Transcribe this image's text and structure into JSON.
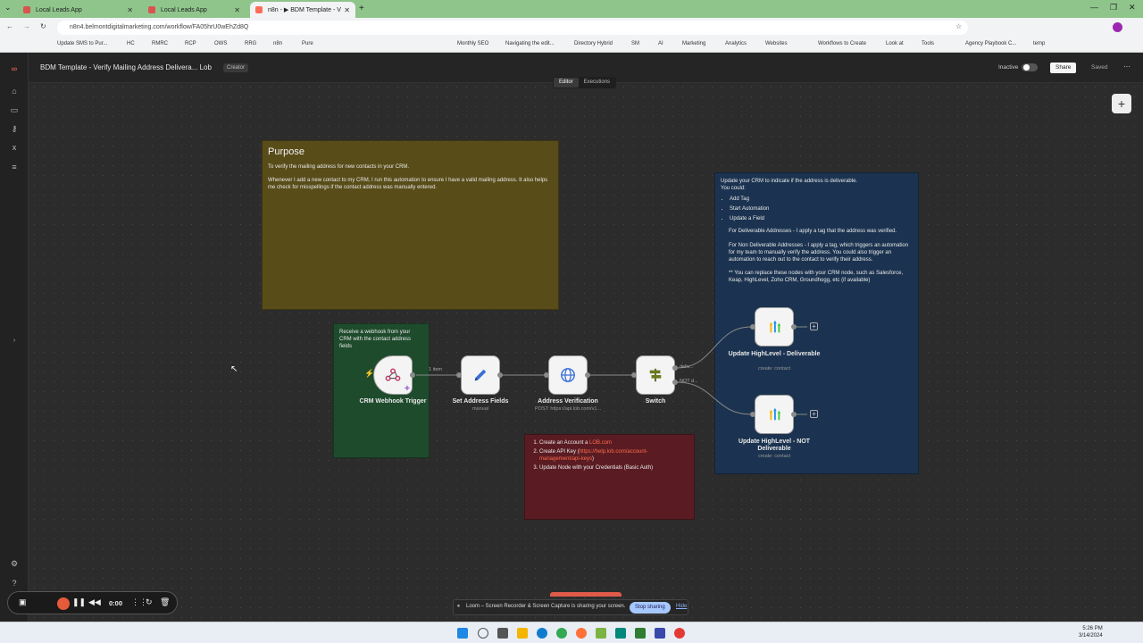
{
  "browser": {
    "tabs": [
      {
        "label": "Local Leads App"
      },
      {
        "label": "Local Leads App"
      },
      {
        "label": "n8n - ▶ BDM Template - V"
      }
    ],
    "url": "n8n4.belmontdigitalmarketing.com/workflow/FA05hrU0wEhZd8Q",
    "bookmarks": [
      "Update SMS to Pur...",
      "HC",
      "RMRC",
      "RCP",
      "OWS",
      "RRG",
      "n8n",
      "Pure",
      "Monthly SEO",
      "Navigating the edit...",
      "Directory Hybrid",
      "SM",
      "AI",
      "Marketing",
      "Analytics",
      "Websites",
      "Workflows to Create",
      "Look at",
      "Tools",
      "Agency Playbook C...",
      "temp"
    ]
  },
  "header": {
    "title": "BDM Template - Verify Mailing Address Delivera... Lob",
    "creator_badge": "Creator",
    "status": "Inactive",
    "share_label": "Share",
    "saved_label": "Saved",
    "editor_tab": "Editor",
    "executions_tab": "Executions"
  },
  "notes": {
    "purpose": {
      "title": "Purpose",
      "line1": "To verify the mailing address for new contacts in your CRM.",
      "line2": "Whenever I add a new contact to my CRM, I run this automation to ensure I have a valid mailing address. It also helps me check for misspellings if the contact address was manually entered."
    },
    "webhook": "Receive a webhook from your CRM with the contact address fields",
    "crm": {
      "intro": "Update your CRM to indicate if the address is deliverable.",
      "could": "You could:",
      "items": [
        "Add Tag",
        "Start Automation",
        "Update a Field"
      ],
      "deliverable": "For Deliverable Addresses - I apply a tag that the address was verified.",
      "non_deliverable": "For Non Deliverable Addresses - I apply a tag, which triggers an automation for my team to manually verify the address. You could also trigger an automation to reach out to the contact to verify their address.",
      "replace": "** You can replace these nodes with your CRM node, such as Salesforce, Keap, HighLevel, Zoho CRM, Groundhogg, etc (if available)"
    },
    "setup": {
      "step1_text": "Create an Account a ",
      "step1_link": "LOB.com",
      "step2_text": "Create API Key (",
      "step2_link": "https://help.lob.com/account-management/api-keys",
      "step2_end": ")",
      "step3_text": "Update Node with your Credentials (Basic Auth)"
    }
  },
  "nodes": {
    "webhook": {
      "label": "CRM Webhook Trigger"
    },
    "set_fields": {
      "label": "Set Address Fields",
      "sub": "manual"
    },
    "address_verification": {
      "label": "Address Verification",
      "sub": "POST: https://api.lob.com/v1..."
    },
    "switch": {
      "label": "Switch",
      "out1": "deliv...",
      "out2": "NOT d..."
    },
    "update_deliverable": {
      "label": "Update HighLevel - Deliverable",
      "sub": "create: contact"
    },
    "update_not_deliverable": {
      "label": "Update HighLevel - NOT Deliverable",
      "sub": "create: contact"
    },
    "connection_label": "1 item"
  },
  "recorder": {
    "time": "0:00"
  },
  "loom": {
    "message": "Loom – Screen Recorder & Screen Capture is sharing your screen.",
    "stop_label": "Stop sharing",
    "hide_label": "Hide"
  },
  "taskbar": {
    "time": "5:26 PM",
    "date": "3/14/2024"
  },
  "colors": {
    "accent": "#ff6d5a",
    "purpose_note": "#584c19",
    "crm_note": "#1b3350",
    "webhook_note": "#1e4b2c",
    "setup_note": "#5a1c22"
  }
}
